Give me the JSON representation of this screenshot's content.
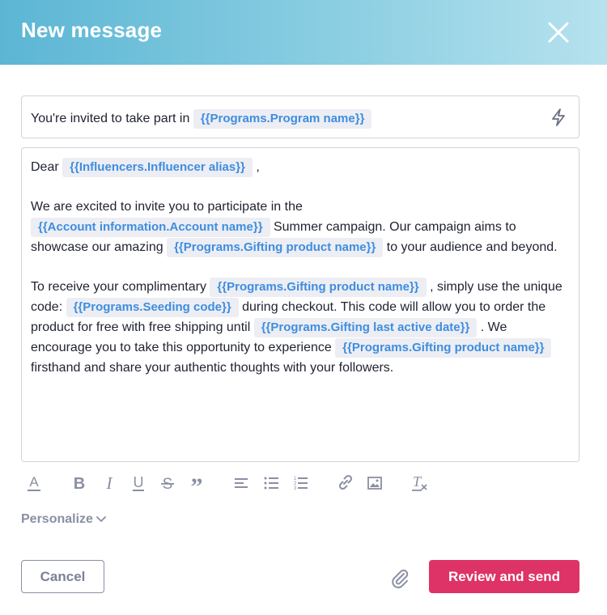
{
  "header": {
    "title": "New message"
  },
  "subject": {
    "prefix": "You're invited to take part in",
    "tag": "{{Programs.Program name}}"
  },
  "body": {
    "greeting": "Dear",
    "greeting_tag": "{{Influencers.Influencer alias}}",
    "greeting_suffix": ",",
    "p1_a": "We are excited to invite you to participate in the",
    "p1_tag1": "{{Account information.Account name}}",
    "p1_b": "Summer campaign. Our campaign aims to showcase our amazing",
    "p1_tag2": "{{Programs.Gifting product name}}",
    "p1_c": "to your audience and beyond.",
    "p2_a": "To receive your complimentary",
    "p2_tag1": "{{Programs.Gifting product name}}",
    "p2_b": ", simply use the unique code:",
    "p2_tag2": "{{Programs.Seeding code}}",
    "p2_c": "during checkout. This code will allow you to order the product for free with free shipping until",
    "p2_tag3": "{{Programs.Gifting last active date}}",
    "p2_d": ". We encourage you to take this opportunity to experience",
    "p2_tag4": "{{Programs.Gifting product name}}",
    "p2_e": "firsthand and share your authentic thoughts with your followers."
  },
  "toolbar": {
    "icons": [
      "text-color-icon",
      "bold-icon",
      "italic-icon",
      "underline-icon",
      "strikethrough-icon",
      "quote-icon",
      "align-icon",
      "bullet-list-icon",
      "numbered-list-icon",
      "link-icon",
      "image-icon",
      "clear-format-icon"
    ],
    "bold_glyph": "B",
    "italic_glyph": "I",
    "underline_glyph": "U",
    "strike_glyph": "S",
    "quote_glyph": "”",
    "color_glyph": "A",
    "clear_glyph": "T"
  },
  "footer": {
    "personalize_label": "Personalize",
    "cancel_label": "Cancel",
    "send_label": "Review and send"
  },
  "colors": {
    "header_start": "#5bb6d4",
    "header_end": "#b6e2ee",
    "tag_text": "#3f8de0",
    "tag_bg": "#eceef3",
    "primary_button": "#de3366",
    "muted": "#8a8fa3"
  }
}
